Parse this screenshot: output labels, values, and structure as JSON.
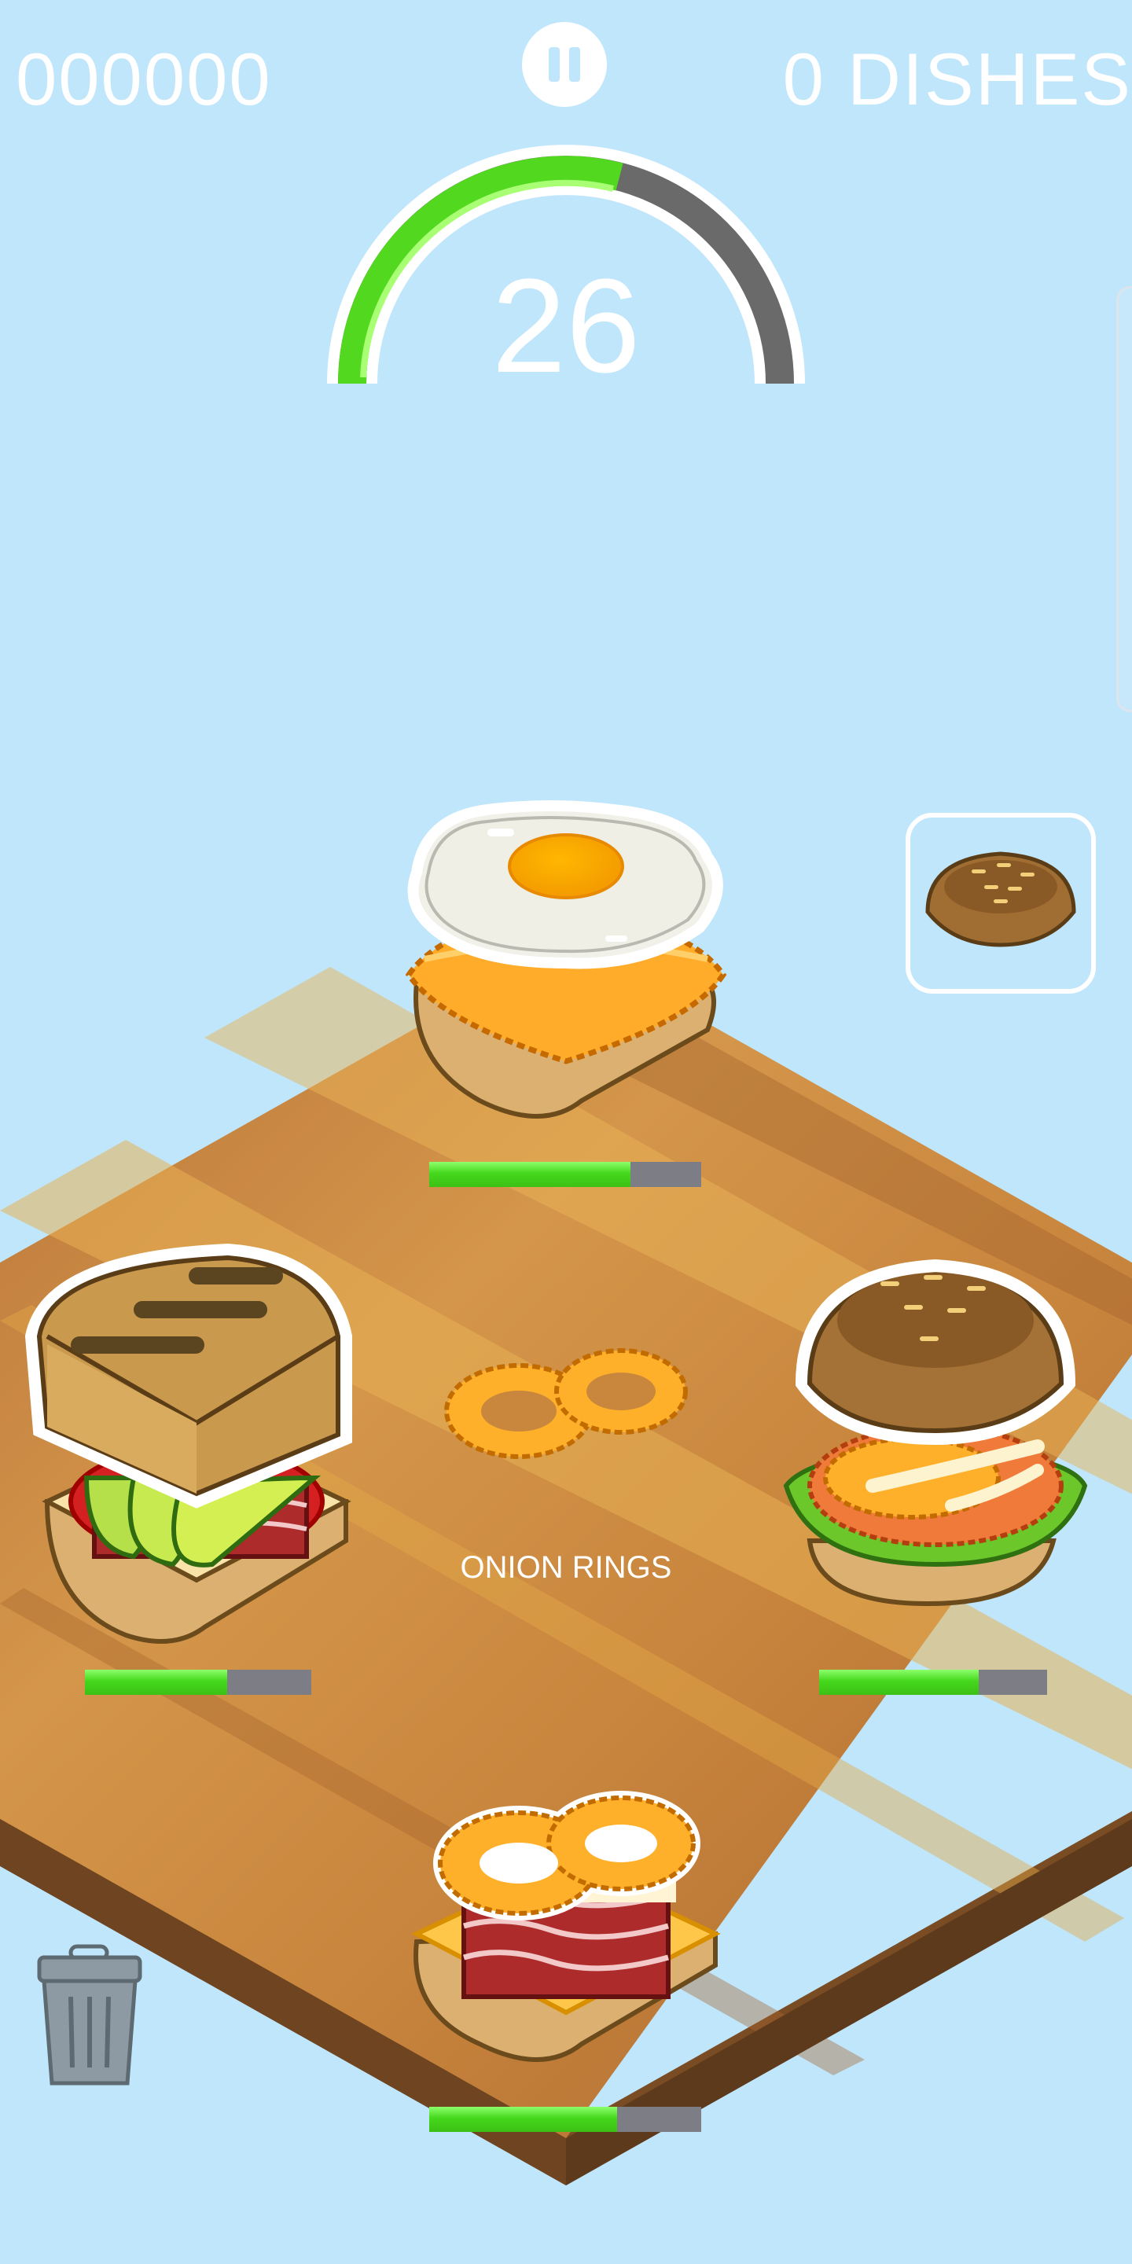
{
  "hud": {
    "score": "000000",
    "dishes": "0 DISHES"
  },
  "timer": {
    "value": "26",
    "fraction_remaining": 0.62
  },
  "floating_label": "ONION RINGS",
  "next_ingredient": {
    "icon": "bun-top-icon"
  },
  "stations": {
    "top": {
      "dish": "fried-egg-hash-brown",
      "progress": 0.74
    },
    "left": {
      "dish": "bacon-avocado-sandwich",
      "progress": 0.63
    },
    "right": {
      "dish": "burger-with-onion-rings",
      "progress": 0.7
    },
    "bottom": {
      "dish": "bacon-onion-ring-stack",
      "progress": 0.69
    }
  },
  "colors": {
    "sky": "#bfe6fb",
    "board": "#c8873e",
    "progress": "#45d81c",
    "track": "#7d7d85"
  }
}
